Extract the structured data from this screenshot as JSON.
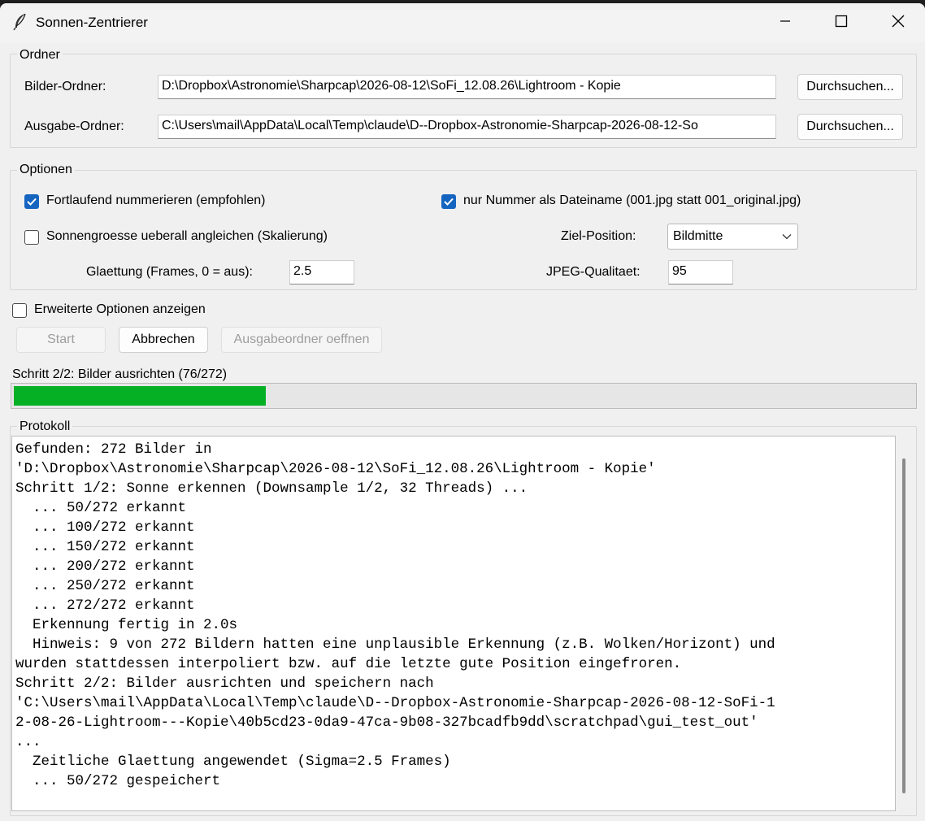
{
  "window": {
    "title": "Sonnen-Zentrierer"
  },
  "ordner": {
    "group_label": "Ordner",
    "bilder_label": "Bilder-Ordner:",
    "bilder_value": "D:\\Dropbox\\Astronomie\\Sharpcap\\2026-08-12\\SoFi_12.08.26\\Lightroom - Kopie",
    "ausgabe_label": "Ausgabe-Ordner:",
    "ausgabe_value": "C:\\Users\\mail\\AppData\\Local\\Temp\\claude\\D--Dropbox-Astronomie-Sharpcap-2026-08-12-So",
    "browse_label": "Durchsuchen..."
  },
  "optionen": {
    "group_label": "Optionen",
    "fortlaufend": {
      "label": "Fortlaufend nummerieren (empfohlen)",
      "checked": true
    },
    "nur_nummer": {
      "label": "nur Nummer als Dateiname (001.jpg statt 001_original.jpg)",
      "checked": true
    },
    "angleichen": {
      "label": "Sonnengroesse ueberall angleichen (Skalierung)",
      "checked": false
    },
    "ziel_label": "Ziel-Position:",
    "ziel_value": "Bildmitte",
    "glaettung_label": "Glaettung (Frames, 0 = aus):",
    "glaettung_value": "2.5",
    "jpeg_label": "JPEG-Qualitaet:",
    "jpeg_value": "95"
  },
  "erweitert": {
    "label": "Erweiterte Optionen anzeigen",
    "checked": false
  },
  "buttons": {
    "start": "Start",
    "abbrechen": "Abbrechen",
    "ausgabe_oeffnen": "Ausgabeordner oeffnen"
  },
  "status": {
    "text": "Schritt 2/2: Bilder ausrichten (76/272)",
    "progress_fraction": 0.2794
  },
  "protokoll": {
    "group_label": "Protokoll",
    "lines": [
      "Gefunden: 272 Bilder in",
      "'D:\\Dropbox\\Astronomie\\Sharpcap\\2026-08-12\\SoFi_12.08.26\\Lightroom - Kopie'",
      "Schritt 1/2: Sonne erkennen (Downsample 1/2, 32 Threads) ...",
      "  ... 50/272 erkannt",
      "  ... 100/272 erkannt",
      "  ... 150/272 erkannt",
      "  ... 200/272 erkannt",
      "  ... 250/272 erkannt",
      "  ... 272/272 erkannt",
      "  Erkennung fertig in 2.0s",
      "  Hinweis: 9 von 272 Bildern hatten eine unplausible Erkennung (z.B. Wolken/Horizont) und",
      "wurden stattdessen interpoliert bzw. auf die letzte gute Position eingefroren.",
      "Schritt 2/2: Bilder ausrichten und speichern nach",
      "'C:\\Users\\mail\\AppData\\Local\\Temp\\claude\\D--Dropbox-Astronomie-Sharpcap-2026-08-12-SoFi-1",
      "2-08-26-Lightroom---Kopie\\40b5cd23-0da9-47ca-9b08-327bcadfb9dd\\scratchpad\\gui_test_out'",
      "...",
      "  Zeitliche Glaettung angewendet (Sigma=2.5 Frames)",
      "  ... 50/272 gespeichert"
    ]
  },
  "colors": {
    "accent": "#1565c0",
    "progress": "#06b025"
  }
}
